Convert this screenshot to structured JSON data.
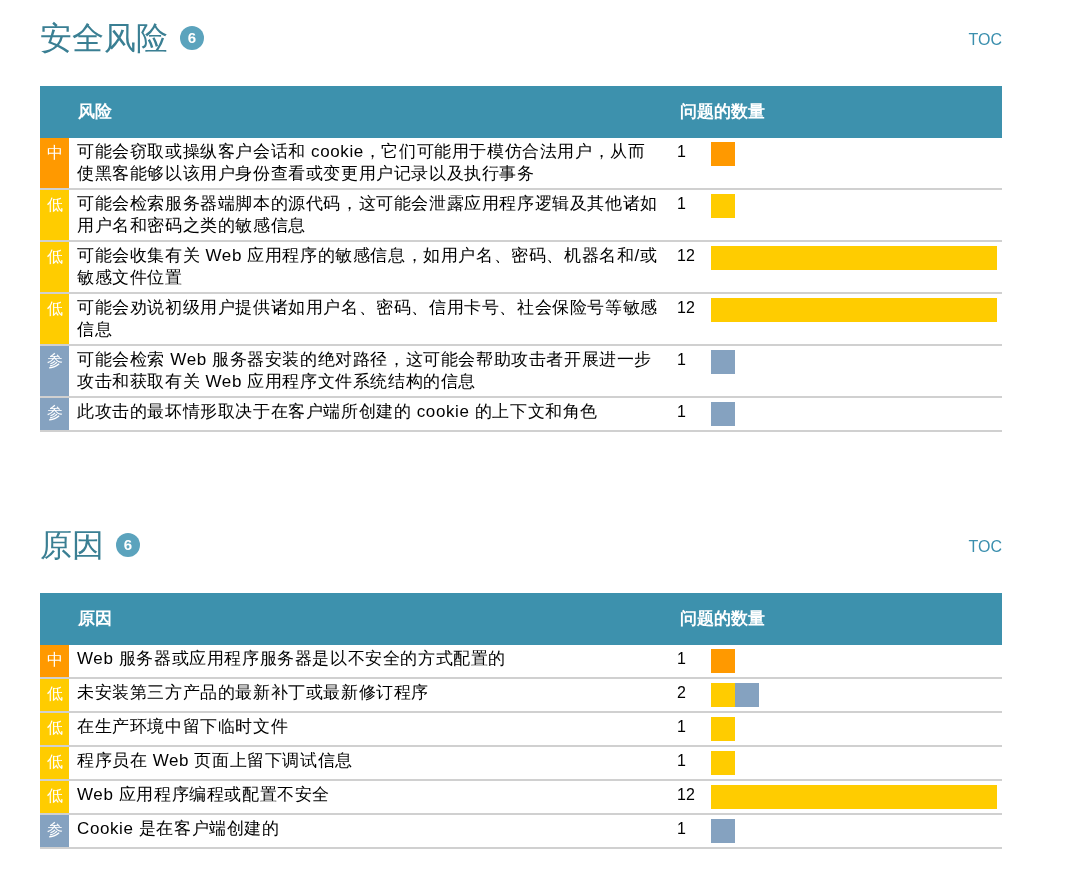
{
  "sections": [
    {
      "title": "安全风险",
      "count": "6",
      "toc": "TOC",
      "columns": [
        "风险",
        "问题的数量"
      ],
      "rows": [
        {
          "severity": "中",
          "color": "#ff9900",
          "text": "可能会窃取或操纵客户会话和 cookie，它们可能用于模仿合法用户，从而使黑客能够以该用户身份查看或变更用户记录以及执行事务",
          "count": "1",
          "segments": [
            {
              "color": "#ff9900",
              "level": 0.0833
            }
          ]
        },
        {
          "severity": "低",
          "color": "#ffcc00",
          "text": "可能会检索服务器端脚本的源代码，这可能会泄露应用程序逻辑及其他诸如用户名和密码之类的敏感信息",
          "count": "1",
          "segments": [
            {
              "color": "#ffcc00",
              "level": 0.0833
            }
          ]
        },
        {
          "severity": "低",
          "color": "#ffcc00",
          "text": "可能会收集有关 Web 应用程序的敏感信息，如用户名、密码、机器名和/或敏感文件位置",
          "count": "12",
          "segments": [
            {
              "color": "#ffcc00",
              "level": 1
            }
          ]
        },
        {
          "severity": "低",
          "color": "#ffcc00",
          "text": "可能会劝说初级用户提供诸如用户名、密码、信用卡号、社会保险号等敏感信息",
          "count": "12",
          "segments": [
            {
              "color": "#ffcc00",
              "level": 1
            }
          ]
        },
        {
          "severity": "参",
          "color": "#85a2c0",
          "text": "可能会检索 Web 服务器安装的绝对路径，这可能会帮助攻击者开展进一步攻击和获取有关 Web 应用程序文件系统结构的信息",
          "count": "1",
          "segments": [
            {
              "color": "#85a2c0",
              "level": 0.0833
            }
          ]
        },
        {
          "severity": "参",
          "color": "#85a2c0",
          "text": "此攻击的最坏情形取决于在客户端所创建的 cookie 的上下文和角色",
          "count": "1",
          "segments": [
            {
              "color": "#85a2c0",
              "level": 0.0833
            }
          ]
        }
      ]
    },
    {
      "title": "原因",
      "count": "6",
      "toc": "TOC",
      "columns": [
        "原因",
        "问题的数量"
      ],
      "rows": [
        {
          "severity": "中",
          "color": "#ff9900",
          "text": "Web 服务器或应用程序服务器是以不安全的方式配置的",
          "count": "1",
          "segments": [
            {
              "color": "#ff9900",
              "level": 0.0833
            }
          ]
        },
        {
          "severity": "低",
          "color": "#ffcc00",
          "text": "未安装第三方产品的最新补丁或最新修订程序",
          "count": "2",
          "segments": [
            {
              "color": "#ffcc00",
              "level": 0.0833
            },
            {
              "color": "#85a2c0",
              "level": 0.0833
            }
          ]
        },
        {
          "severity": "低",
          "color": "#ffcc00",
          "text": "在生产环境中留下临时文件",
          "count": "1",
          "segments": [
            {
              "color": "#ffcc00",
              "level": 0.0833
            }
          ]
        },
        {
          "severity": "低",
          "color": "#ffcc00",
          "text": "程序员在 Web 页面上留下调试信息",
          "count": "1",
          "segments": [
            {
              "color": "#ffcc00",
              "level": 0.0833
            }
          ]
        },
        {
          "severity": "低",
          "color": "#ffcc00",
          "text": "Web 应用程序编程或配置不安全",
          "count": "12",
          "segments": [
            {
              "color": "#ffcc00",
              "level": 1
            }
          ]
        },
        {
          "severity": "参",
          "color": "#85a2c0",
          "text": "Cookie 是在客户端创建的",
          "count": "1",
          "segments": [
            {
              "color": "#85a2c0",
              "level": 0.0833
            }
          ]
        }
      ]
    }
  ]
}
